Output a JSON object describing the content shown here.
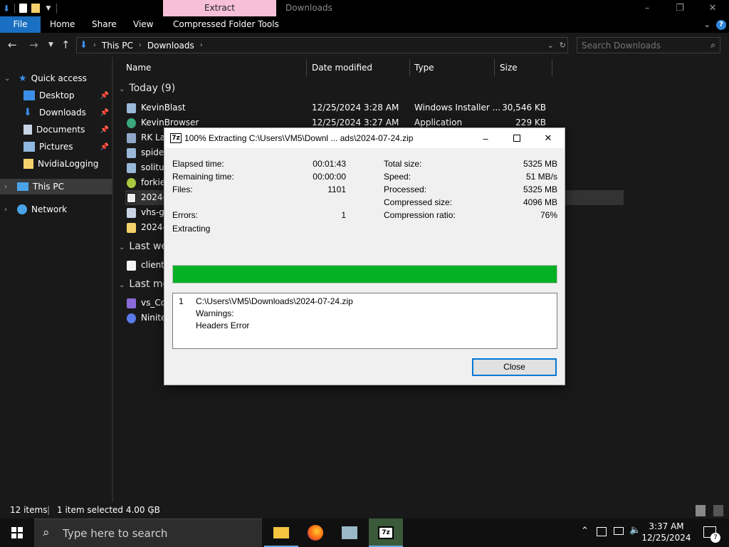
{
  "window": {
    "context_tab": "Extract",
    "title": "Downloads"
  },
  "ribbon": {
    "tabs": [
      "File",
      "Home",
      "Share",
      "View",
      "Compressed Folder Tools"
    ]
  },
  "address": {
    "crumbs": [
      "This PC",
      "Downloads"
    ]
  },
  "search": {
    "placeholder": "Search Downloads"
  },
  "nav": {
    "quick_access": "Quick access",
    "items": [
      "Desktop",
      "Downloads",
      "Documents",
      "Pictures",
      "NvidiaLogging"
    ],
    "this_pc": "This PC",
    "network": "Network"
  },
  "columns": [
    "Name",
    "Date modified",
    "Type",
    "Size"
  ],
  "groups": [
    "Today (9)",
    "Last we",
    "Last mo"
  ],
  "files": [
    {
      "name": "KevinBlast",
      "date": "12/25/2024 3:28 AM",
      "type": "Windows Installer ...",
      "size": "30,546 KB"
    },
    {
      "name": "KevinBrowser",
      "date": "12/25/2024 3:27 AM",
      "type": "Application",
      "size": "229 KB"
    },
    {
      "name": "RK Lau",
      "date": "",
      "type": "",
      "size": ""
    },
    {
      "name": "spider",
      "date": "",
      "type": "",
      "size": ""
    },
    {
      "name": "solituc",
      "date": "",
      "type": "",
      "size": ""
    },
    {
      "name": "forkie",
      "date": "",
      "type": "",
      "size": ""
    },
    {
      "name": "2024-0",
      "date": "",
      "type": "",
      "size": ""
    },
    {
      "name": "vhs-gi",
      "date": "",
      "type": "",
      "size": ""
    },
    {
      "name": "2024-0",
      "date": "",
      "type": "",
      "size": ""
    }
  ],
  "files_last_week": [
    {
      "name": "client_"
    }
  ],
  "files_last_month": [
    {
      "name": "vs_Co"
    },
    {
      "name": "Ninite"
    }
  ],
  "status": {
    "items": "12 items",
    "selected": "1 item selected  4.00 GB"
  },
  "taskbar": {
    "search_placeholder": "Type here to search",
    "time": "3:37 AM",
    "date": "12/25/2024",
    "notification_count": "7"
  },
  "dialog": {
    "title": "100% Extracting C:\\Users\\VM5\\Downl ... ads\\2024-07-24.zip",
    "left_stats": [
      {
        "label": "Elapsed time:",
        "value": "00:01:43"
      },
      {
        "label": "Remaining time:",
        "value": "00:00:00"
      },
      {
        "label": "Files:",
        "value": "1101"
      },
      {
        "label": "Errors:",
        "value": "1"
      }
    ],
    "right_stats": [
      {
        "label": "Total size:",
        "value": "5325 MB"
      },
      {
        "label": "Speed:",
        "value": "51 MB/s"
      },
      {
        "label": "Processed:",
        "value": "5325 MB"
      },
      {
        "label": "Compressed size:",
        "value": "4096 MB"
      },
      {
        "label": "Compression ratio:",
        "value": "76%"
      }
    ],
    "operation": "Extracting",
    "progress": 1.0,
    "log": {
      "index": "1",
      "path": "C:\\Users\\VM5\\Downloads\\2024-07-24.zip",
      "warnings": "Warnings:",
      "error": "Headers Error"
    },
    "close_label": "Close"
  },
  "colors": {
    "accent": "#1a6fc2",
    "progress": "#06b025",
    "context_tab": "#f7bfd8"
  }
}
